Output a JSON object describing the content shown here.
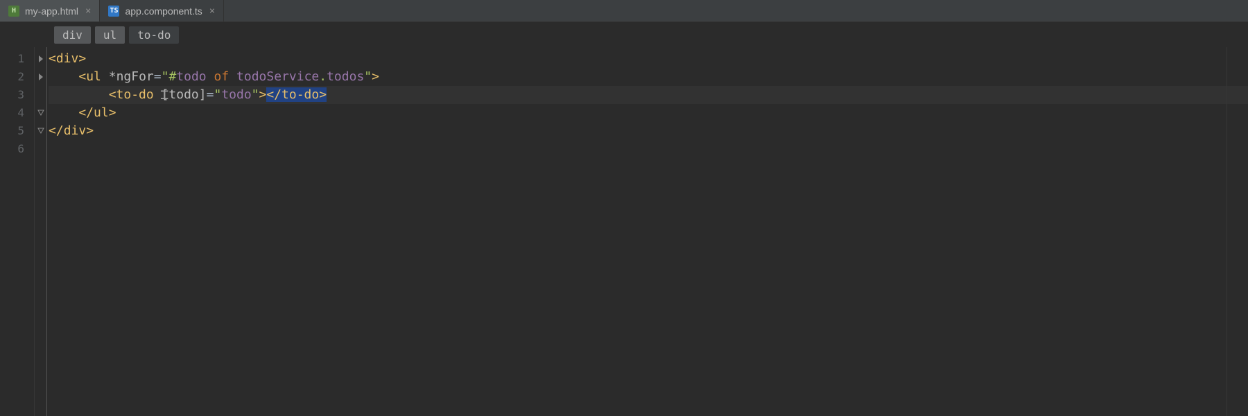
{
  "tabs": [
    {
      "label": "my-app.html",
      "icon": "H",
      "iconType": "html",
      "active": true
    },
    {
      "label": "app.component.ts",
      "icon": "TS",
      "iconType": "ts",
      "active": false
    }
  ],
  "breadcrumbs": [
    {
      "label": "div"
    },
    {
      "label": "ul"
    },
    {
      "label": "to-do",
      "current": true
    }
  ],
  "line_numbers": [
    "1",
    "2",
    "3",
    "4",
    "5",
    "6"
  ],
  "code": {
    "l1": {
      "open": "<",
      "tag": "div",
      "close": ">"
    },
    "l2": {
      "indent": "    ",
      "open": "<",
      "tag": "ul",
      "sp1": " ",
      "dir": "*ngFor",
      "eq": "=",
      "q1": "\"",
      "hash": "#",
      "var": "todo",
      "sp2": " ",
      "of": "of",
      "sp3": " ",
      "svc": "todoService",
      "dot": ".",
      "prop": "todos",
      "q2": "\"",
      "close": ">"
    },
    "l3": {
      "indent": "        ",
      "open": "<",
      "tag": "to-do",
      "sp1": " ",
      "bind_open": "[",
      "bind_name": "todo",
      "bind_close": "]",
      "eq": "=",
      "q1": "\"",
      "val": "todo",
      "q2": "\"",
      "mid": ">",
      "close_open": "</",
      "close_tag": "to-do",
      "close": ">"
    },
    "l4": {
      "indent": "    ",
      "open": "</",
      "tag": "ul",
      "close": ">"
    },
    "l5": {
      "open": "</",
      "tag": "div",
      "close": ">"
    }
  }
}
